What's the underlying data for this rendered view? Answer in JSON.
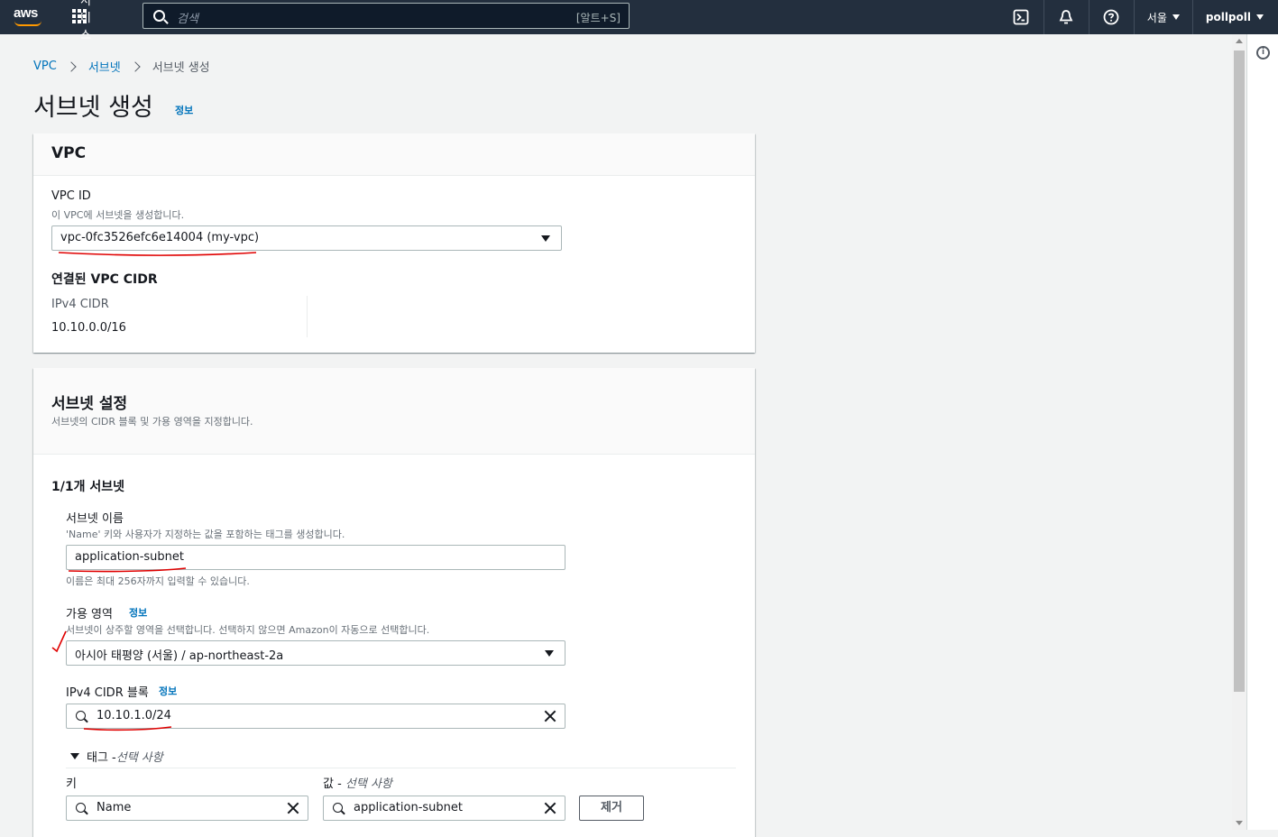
{
  "nav": {
    "logo_text": "aws",
    "services_label": "서비스",
    "search_placeholder": "검색",
    "search_shortcut": "[알트+S]",
    "region": "서울",
    "user": "pollpoll"
  },
  "breadcrumb": {
    "items": [
      "VPC",
      "서브넷"
    ],
    "current": "서브넷 생성"
  },
  "page": {
    "title": "서브넷 생성",
    "info": "정보"
  },
  "vpc_panel": {
    "heading": "VPC",
    "vpc_id_label": "VPC ID",
    "vpc_id_desc": "이 VPC에 서브넷을 생성합니다.",
    "vpc_id_value": "vpc-0fc3526efc6e14004 (my-vpc)",
    "cidr_heading": "연결된 VPC CIDR",
    "ipv4_label": "IPv4 CIDR",
    "ipv4_value": "10.10.0.0/16"
  },
  "subnet_panel": {
    "heading": "서브넷 설정",
    "desc": "서브넷의 CIDR 블록 및 가용 영역을 지정합니다.",
    "count": "1/1개 서브넷",
    "name_label": "서브넷 이름",
    "name_desc": "'Name' 키와 사용자가 지정하는 값을 포함하는 태그를 생성합니다.",
    "name_value": "application-subnet",
    "name_hint": "이름은 최대 256자까지 입력할 수 있습니다.",
    "az_label": "가용 영역",
    "az_info": "정보",
    "az_desc": "서브넷이 상주할 영역을 선택합니다. 선택하지 않으면 Amazon이 자동으로 선택합니다.",
    "az_value": "아시아 태평양 (서울) / ap-northeast-2a",
    "cidr_label": "IPv4 CIDR 블록",
    "cidr_info": "정보",
    "cidr_value": "10.10.1.0/24",
    "tags_toggle": "태그 - ",
    "tags_optional": "선택 사항",
    "key_label": "키",
    "value_label": "값 - ",
    "value_optional": "선택 사항",
    "key_value": "Name",
    "tag_value": "application-subnet",
    "remove_button": "제거"
  },
  "colors": {
    "nav_bg": "#232f3e",
    "link": "#0073bb",
    "annotation": "#e00000"
  }
}
